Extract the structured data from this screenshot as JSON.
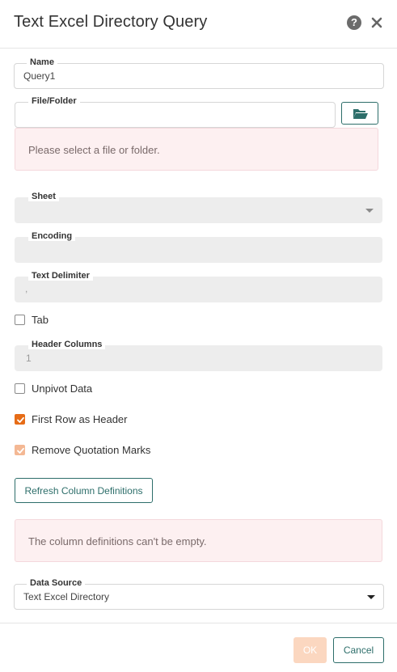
{
  "header": {
    "title": "Text Excel Directory Query",
    "help_icon_glyph": "?",
    "icons": [
      "question-circle-icon",
      "close-icon"
    ]
  },
  "fields": {
    "name": {
      "label": "Name",
      "value": "Query1"
    },
    "file_folder": {
      "label": "File/Folder",
      "value": "",
      "folder_icon": "folder-open-icon"
    },
    "file_alert": "Please select a file or folder.",
    "sheet": {
      "label": "Sheet",
      "value": ""
    },
    "encoding": {
      "label": "Encoding",
      "value": ""
    },
    "text_delimiter": {
      "label": "Text Delimiter",
      "value": ","
    },
    "header_columns": {
      "label": "Header Columns",
      "value": "1"
    },
    "data_source": {
      "label": "Data Source",
      "value": "Text Excel Directory"
    }
  },
  "checkboxes": {
    "tab": {
      "label": "Tab",
      "checked": false
    },
    "unpivot": {
      "label": "Unpivot Data",
      "checked": false
    },
    "first_row_header": {
      "label": "First Row as Header",
      "checked": true
    },
    "remove_quotes": {
      "label": "Remove Quotation Marks",
      "checked": true,
      "disabled": true
    }
  },
  "buttons": {
    "refresh": "Refresh Column Definitions",
    "ok": "OK",
    "cancel": "Cancel"
  },
  "column_alert": "The column definitions can't be empty.",
  "colors": {
    "accent_teal": "#2d6e6a",
    "accent_orange": "#e66c17",
    "alert_bg": "#fdf0f1",
    "disabled_bg": "#ededed"
  }
}
